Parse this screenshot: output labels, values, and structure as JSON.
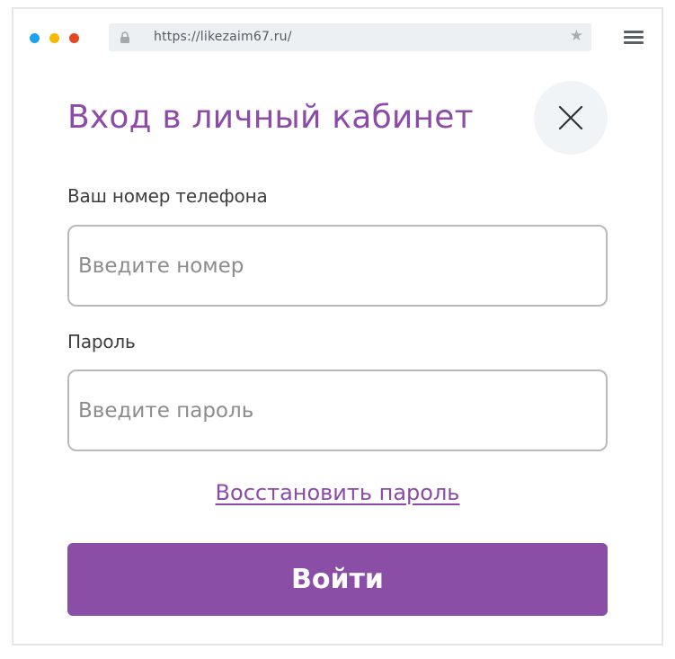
{
  "browser": {
    "url": "https://likezaim67.ru/",
    "icons": [
      "lock-icon",
      "star-icon",
      "menu-icon"
    ],
    "dot_colors": [
      "#1da1f2",
      "#f6b900",
      "#e4471e"
    ]
  },
  "dialog": {
    "title": "Вход в личный кабинет",
    "close_icon": "close-icon",
    "phone": {
      "label": "Ваш номер телефона",
      "placeholder": "Введите номер",
      "value": ""
    },
    "password": {
      "label": "Пароль",
      "placeholder": "Введите пароль",
      "value": ""
    },
    "restore_link": "Восстановить пароль",
    "submit_label": "Войти",
    "accent_color": "#8a4ea6"
  }
}
